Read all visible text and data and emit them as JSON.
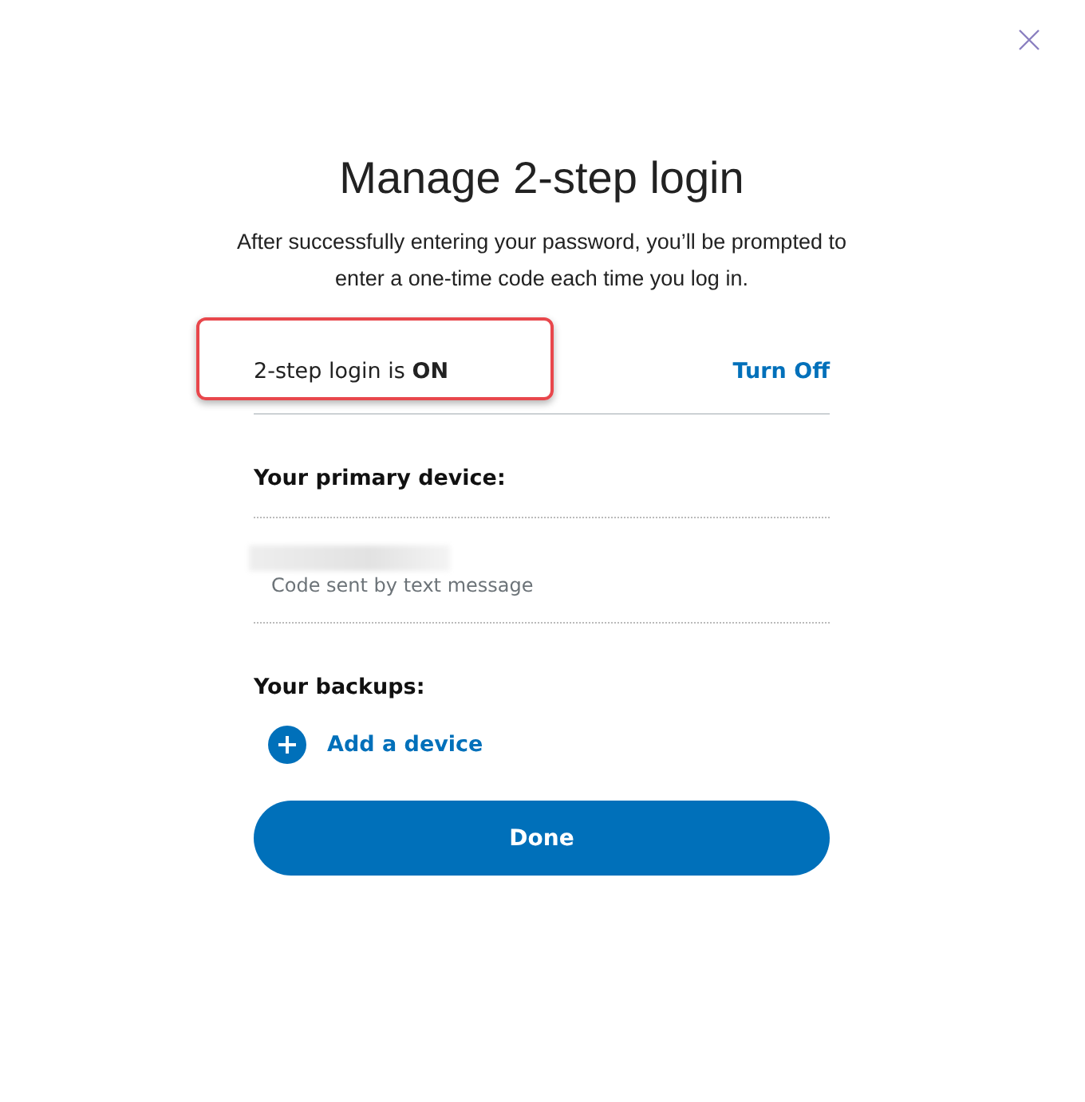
{
  "dialog": {
    "title": "Manage 2-step login",
    "description": "After successfully entering your password, you’ll be prompted to enter a one-time code each time you log in."
  },
  "status": {
    "text": "2-step login is **ON**",
    "highlighted": true,
    "action": "Turn Off"
  },
  "primary_device": {
    "heading": "Your primary device:",
    "redacted": true,
    "caption": "Code sent by text message"
  },
  "backups": {
    "heading": "Your backups:",
    "add_label": "Add a device"
  },
  "buttons": [
    "Done"
  ]
}
